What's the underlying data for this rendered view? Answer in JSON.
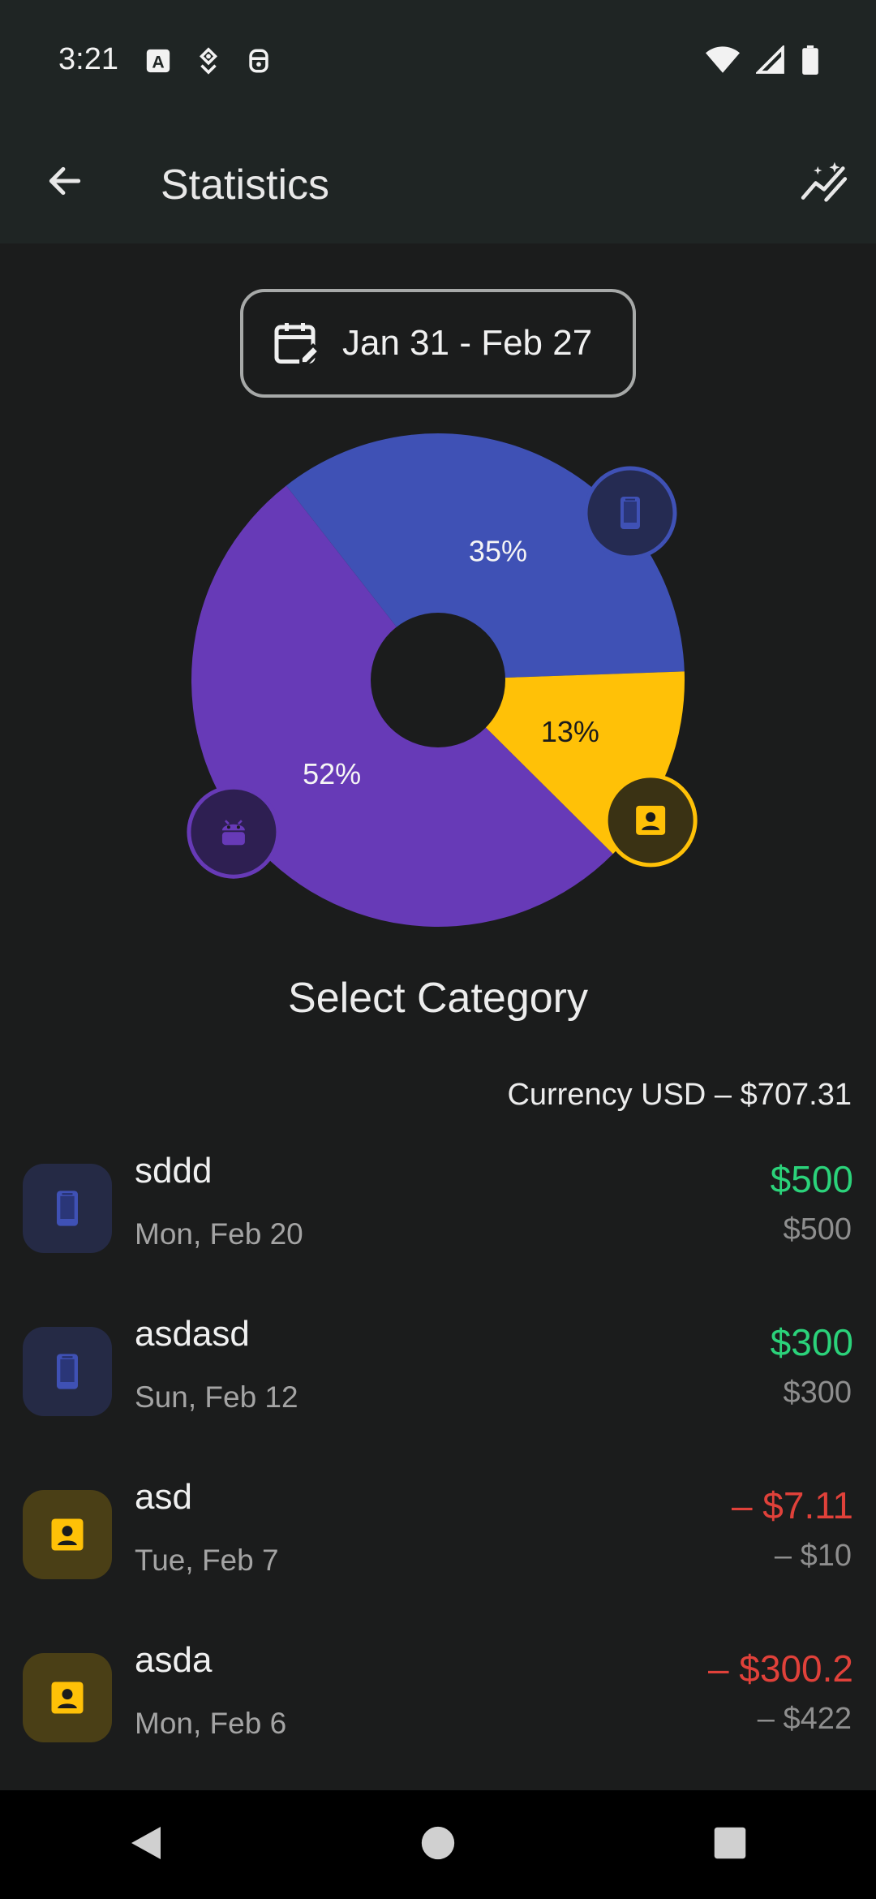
{
  "status_bar": {
    "time": "3:21"
  },
  "app_bar": {
    "title": "Statistics"
  },
  "date_range": {
    "label": "Jan 31 - Feb 27"
  },
  "chart_data": {
    "type": "pie",
    "donut": true,
    "slices": [
      {
        "label": "35%",
        "value": 35,
        "color": "#3f51b5",
        "icon": "phone-icon"
      },
      {
        "label": "13%",
        "value": 13,
        "color": "#ffc107",
        "icon": "contact-card-icon"
      },
      {
        "label": "52%",
        "value": 52,
        "color": "#673ab7",
        "icon": "android-icon"
      }
    ]
  },
  "section_title": "Select Category",
  "currency_summary": "Currency USD – $707.31",
  "transactions": [
    {
      "name": "sddd",
      "date": "Mon, Feb 20",
      "amount": "$500",
      "sub_amount": "$500",
      "type": "income",
      "icon": "phone-icon",
      "icon_color": "#3f51b5",
      "icon_bg": "#252a45"
    },
    {
      "name": "asdasd",
      "date": "Sun, Feb 12",
      "amount": "$300",
      "sub_amount": "$300",
      "type": "income",
      "icon": "phone-icon",
      "icon_color": "#3f51b5",
      "icon_bg": "#252a45"
    },
    {
      "name": "asd",
      "date": "Tue, Feb 7",
      "amount": "– $7.11",
      "sub_amount": "– $10",
      "type": "expense",
      "icon": "contact-card-icon",
      "icon_color": "#ffc107",
      "icon_bg": "#4a3f16"
    },
    {
      "name": "asda",
      "date": "Mon, Feb 6",
      "amount": "– $300.2",
      "sub_amount": "– $422",
      "type": "expense",
      "icon": "contact-card-icon",
      "icon_color": "#ffc107",
      "icon_bg": "#4a3f16"
    }
  ],
  "colors": {
    "income": "#2bd27a",
    "expense": "#e0413a"
  }
}
